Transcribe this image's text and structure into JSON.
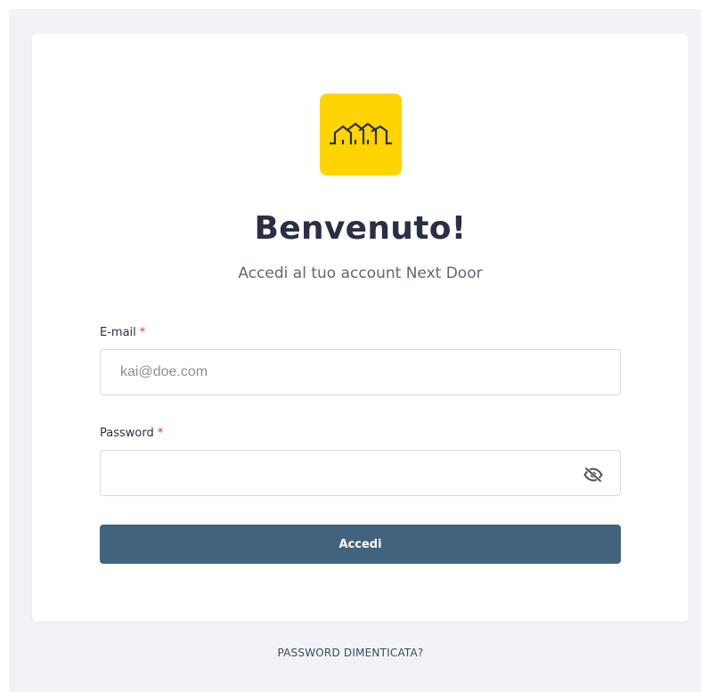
{
  "brand": {
    "logo_icon": "houses-outline-icon",
    "logo_bg_color": "#FFD400",
    "logo_line_color": "#2b2f2f"
  },
  "login": {
    "title": "Benvenuto!",
    "subtitle": "Accedi al tuo account Next Door",
    "email": {
      "label": "E-mail",
      "required_mark": "*",
      "value": "",
      "placeholder": "kai@doe.com"
    },
    "password": {
      "label": "Password",
      "required_mark": "*",
      "value": "",
      "placeholder": "",
      "toggle_icon": "eye-slash-icon"
    },
    "submit_label": "Accedi"
  },
  "footer": {
    "forgot_password_label": "PASSWORD DIMENTICATA?"
  },
  "colors": {
    "page_bg": "#f2f3f7",
    "card_bg": "#ffffff",
    "primary_button": "#42637d",
    "required": "#d23b3b"
  }
}
